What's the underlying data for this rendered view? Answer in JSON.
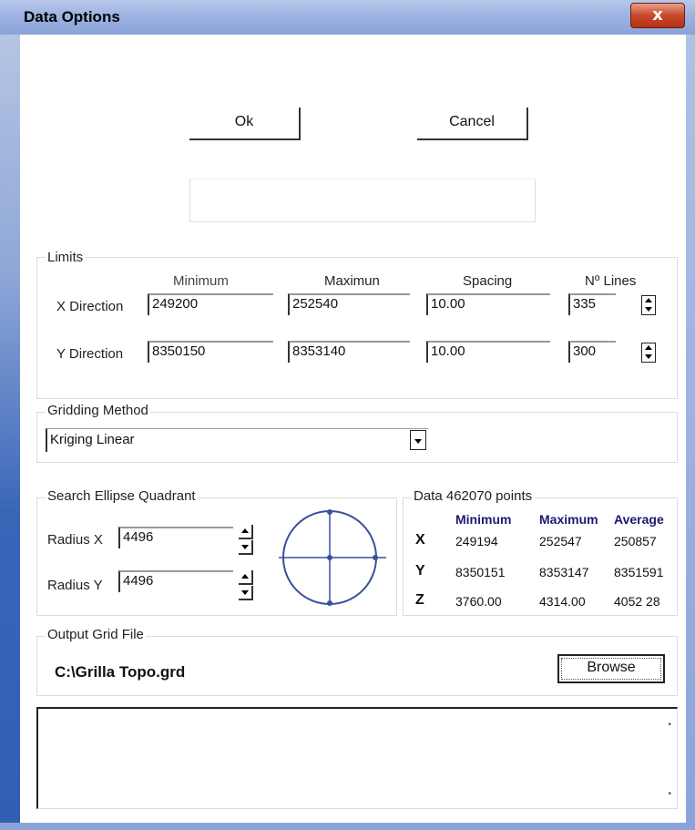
{
  "window": {
    "title": "Data Options",
    "close_glyph": "x"
  },
  "actions": {
    "ok_label": "Ok",
    "cancel_label": "Cancel"
  },
  "limits": {
    "group_label": "Limits",
    "col_min": "Minimum",
    "col_max": "Maximun",
    "col_spacing": "Spacing",
    "col_lines": "Nº Lines",
    "x": {
      "label": "X Direction",
      "min": "249200",
      "max": "252540",
      "spacing": "10.00",
      "lines": "335"
    },
    "y": {
      "label": "Y Direction",
      "min": "8350150",
      "max": "8353140",
      "spacing": "10.00",
      "lines": "300"
    }
  },
  "gridding": {
    "group_label": "Gridding Method",
    "selected": "Kriging Linear"
  },
  "ellipse": {
    "group_label": "Search Ellipse Quadrant",
    "radius_x_label": "Radius X",
    "radius_x": "4496",
    "radius_y_label": "Radius Y",
    "radius_y": "4496",
    "diagram_color": "#3a4f9e"
  },
  "data_stats": {
    "label": "Data",
    "points": "462070 points",
    "headers": [
      "Minimum",
      "Maximum",
      "Average"
    ],
    "rows": [
      {
        "axis": "X",
        "min": "249194",
        "max": "252547",
        "avg": "250857"
      },
      {
        "axis": "Y",
        "min": "8350151",
        "max": "8353147",
        "avg": "8351591"
      },
      {
        "axis": "Z",
        "min": "3760.00",
        "max": "4314.00",
        "avg": "4052 28"
      }
    ]
  },
  "output": {
    "group_label": "Output Grid File",
    "path": "C:\\Grilla Topo.grd",
    "browse_label": "Browse"
  },
  "icons": [
    "close-icon",
    "spin-up-icon",
    "spin-down-icon",
    "dropdown-arrow-icon",
    "ellipse-quadrant-icon"
  ]
}
